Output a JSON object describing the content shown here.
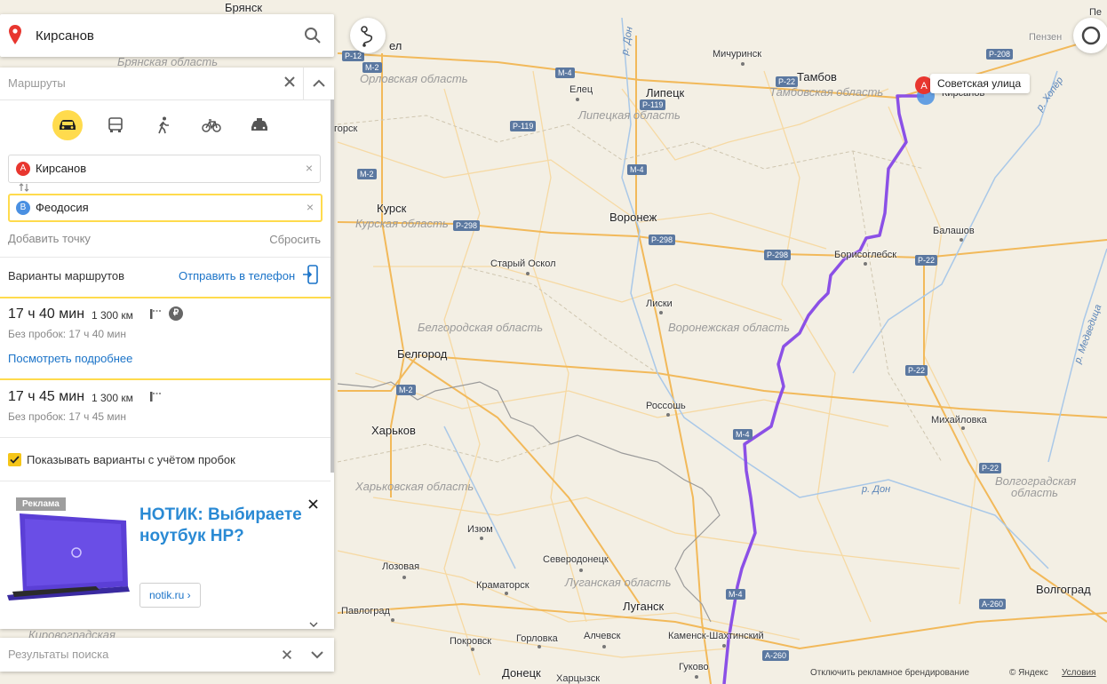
{
  "search": {
    "query": "Кирсанов"
  },
  "routes_panel": {
    "title": "Маршруты",
    "from": {
      "badge": "A",
      "value": "Кирсанов"
    },
    "to": {
      "badge": "B",
      "value": "Феодосия"
    },
    "add_point": "Добавить точку",
    "reset": "Сбросить",
    "variants_title": "Варианты маршрутов",
    "send_to_phone": "Отправить в телефон",
    "variants": [
      {
        "time": "17 ч 40 мин",
        "distance": "1 300 км",
        "no_traffic": "Без пробок: 17 ч 40 мин",
        "details": "Посмотреть подробнее",
        "paid": "₽"
      },
      {
        "time": "17 ч 45 мин",
        "distance": "1 300 км",
        "no_traffic": "Без пробок: 17 ч 45 мин"
      }
    ],
    "traffic_checkbox": "Показывать варианты с учётом пробок",
    "ad": {
      "tag": "Реклама",
      "title": "НОТИК: Выбираете ноутбук HP?",
      "button": "notik.ru ›"
    }
  },
  "results_panel": {
    "title": "Результаты поиска"
  },
  "map": {
    "pin": {
      "badge": "A",
      "label": "Советская улица"
    },
    "cities": {
      "bryansk": "Брянск",
      "orel": "ел",
      "michurinsk": "Мичуринск",
      "tambov": "Тамбов",
      "penza": "Пензен",
      "penza2": "Пе",
      "elets": "Елец",
      "lipetsk": "Липецк",
      "kirsanov": "Кирсанов",
      "orsk": "горск",
      "kursk": "Курск",
      "voronezh": "Воронеж",
      "balashov": "Балашов",
      "borisoglebsk": "Борисоглебск",
      "stary_oskol": "Старый Оскол",
      "liski": "Лиски",
      "belgorod": "Белгород",
      "rossosh": "Россошь",
      "kharkov": "Харьков",
      "mikhailovka": "Михайловка",
      "izyum": "Изюм",
      "severodonetsk": "Северодонецк",
      "lozovaya": "Лозовая",
      "kramatorsk": "Краматорск",
      "volgograd": "Волгоград",
      "lugansk": "Луганск",
      "pavlograd": "Павлоград",
      "alchevsk": "Алчевск",
      "kamensk": "Каменск-Шахтинский",
      "pokrovsk": "Покровск",
      "gorlovka": "Горловка",
      "gukovo": "Гуково",
      "donetsk": "Донецк",
      "khartsyzsk": "Харцызск"
    },
    "regions": {
      "bryanskaya": "Брянская область",
      "orlovskaya": "Орловская область",
      "tambovskaya": "Тамбовская область",
      "lipetskaya": "Липецкая область",
      "kurskaya": "Курская область",
      "belgorodskaya": "Белгородская область",
      "voronezhskaya": "Воронежская область",
      "kharkovskaya": "Харьковская область",
      "luganskaya": "Луганская область",
      "volgogradskaya_1": "Волгоградская",
      "volgogradskaya_2": "область",
      "kirovogradskaya": "Кировоградская"
    },
    "rivers": {
      "don1": "р. Дон",
      "khoper": "р. Хопёр",
      "medveditsa": "р. Медведица",
      "don2": "р. Дон"
    },
    "road_shields": {
      "m2a": "M-2",
      "p120": "P-12",
      "m4a": "M-4",
      "p119": "P-119",
      "p119b": "P-119",
      "p22a": "P-22",
      "p208": "P-208",
      "m2b": "M-2",
      "m4b": "M-4",
      "p298a": "P-298",
      "p298b": "P-298",
      "p298c": "P-298",
      "p22b": "P-22",
      "p22c": "P-22",
      "m2c": "M-2",
      "m4c": "M-4",
      "p22d": "P-22",
      "m4d": "M-4",
      "a260a": "A-260",
      "a260b": "A-260"
    },
    "footer": {
      "disable_branding": "Отключить рекламное брендирование",
      "copyright": "© Яндекс",
      "terms": "Условия"
    }
  },
  "colors": {
    "route": "#8b50e6",
    "accent": "#ffdb4d",
    "link": "#1a73c8",
    "pin": "#e8362f",
    "badge_b": "#4a90e2"
  }
}
